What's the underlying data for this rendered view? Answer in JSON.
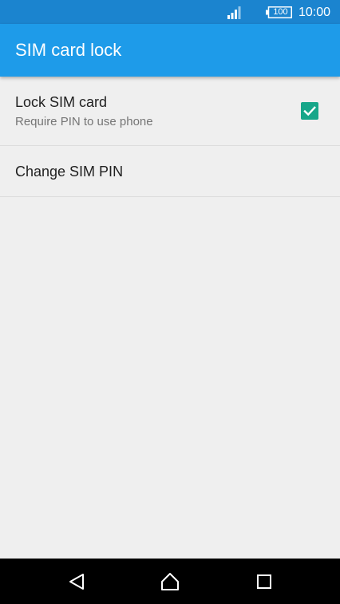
{
  "status_bar": {
    "battery_level": "100",
    "time": "10:00",
    "icons": [
      "signal-icon",
      "battery-icon"
    ]
  },
  "toolbar": {
    "title": "SIM card lock"
  },
  "settings": {
    "lock_sim": {
      "title": "Lock SIM card",
      "summary": "Require PIN to use phone",
      "checked": true
    },
    "change_pin": {
      "title": "Change SIM PIN"
    }
  },
  "nav_bar": {
    "icons": [
      "back-icon",
      "home-icon",
      "recents-icon"
    ]
  },
  "colors": {
    "status_bar": "#1b84cf",
    "toolbar": "#1e9be9",
    "checkbox": "#17a689",
    "background": "#efefef"
  }
}
